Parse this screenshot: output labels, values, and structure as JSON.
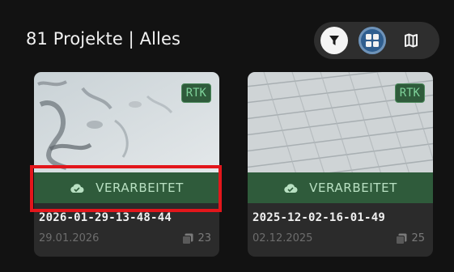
{
  "header": {
    "title": "81 Projekte | Alles"
  },
  "toolbar": {
    "filter_icon": "filter-icon",
    "grid_icon": "grid-view-icon",
    "map_icon": "map-icon"
  },
  "projects": [
    {
      "badge": "RTK",
      "status": "VERARBEITET",
      "name": "2026-01-29-13-48-44",
      "date": "29.01.2026",
      "count": "23"
    },
    {
      "badge": "RTK",
      "status": "VERARBEITET",
      "name": "2025-12-02-16-01-49",
      "date": "02.12.2025",
      "count": "25"
    }
  ],
  "colors": {
    "background": "#121212",
    "card": "#2b2b2b",
    "status_bg": "#2f5b3b",
    "status_text": "#b8e0c2",
    "accent_blue": "#2f5e8f",
    "highlight": "#e3161b"
  }
}
